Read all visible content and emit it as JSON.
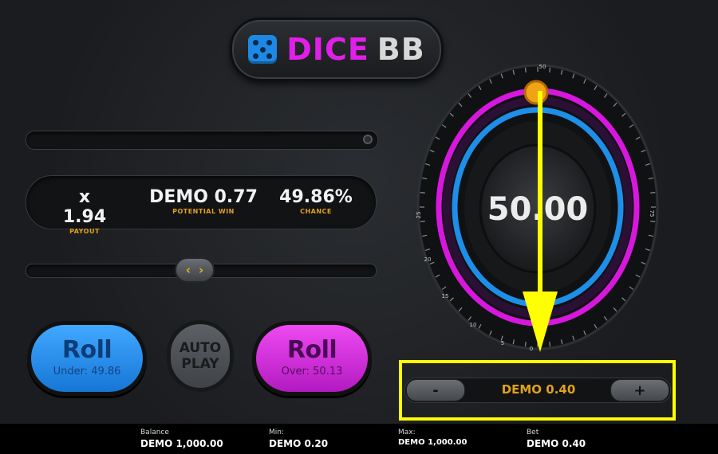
{
  "logo": {
    "word1": "DICE",
    "word2": "BB",
    "icon": "dice-icon"
  },
  "stats": {
    "payout": {
      "value": "x 1.94",
      "label": "PAYOUT"
    },
    "potential_win": {
      "value": "DEMO 0.77",
      "label": "POTENTIAL WIN"
    },
    "chance": {
      "value": "49.86%",
      "label": "CHANCE"
    }
  },
  "slider": {
    "left_arrow": "‹",
    "right_arrow": "›"
  },
  "buttons": {
    "roll_under": {
      "title": "Roll",
      "sub": "Under: 49.86"
    },
    "auto_play": {
      "line1": "AUTO",
      "line2": "PLAY"
    },
    "roll_over": {
      "title": "Roll",
      "sub": "Over: 50.13"
    }
  },
  "dial": {
    "result": "50.00",
    "ticks": [
      "0",
      "5",
      "10",
      "15",
      "20",
      "25",
      "50",
      "75"
    ]
  },
  "bet": {
    "minus": "-",
    "plus": "+",
    "value": "DEMO 0.40"
  },
  "footer": {
    "balance": {
      "label": "Balance",
      "value": "DEMO 1,000.00"
    },
    "min": {
      "label": "Min:",
      "value": "DEMO 0.20"
    },
    "max": {
      "label": "Max:",
      "value": "DEMO 1,000.00"
    },
    "bet": {
      "label": "Bet",
      "value": "DEMO 0.40"
    }
  },
  "colors": {
    "under": "#1e88e5",
    "over": "#e020e8",
    "accent": "#e0a21b",
    "highlight": "#ffff00"
  }
}
